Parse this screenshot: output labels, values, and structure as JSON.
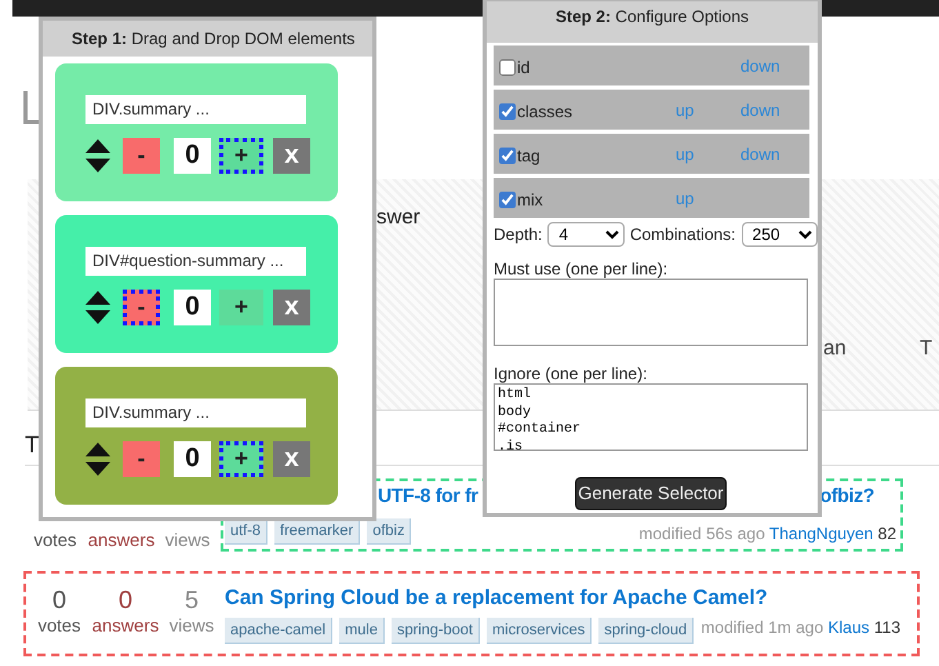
{
  "hero": {
    "text": "swer",
    "captions": [
      "an",
      "T"
    ]
  },
  "section_title": "T",
  "questions": [
    {
      "kind": "partial",
      "color": "#3ed98a",
      "votes_label": "votes",
      "answers_label": "answers",
      "views_label": "views",
      "title_parts": [
        "UTF-8 for fr",
        "ofbiz?"
      ],
      "tags": [
        "utf-8",
        "freemarker",
        "ofbiz"
      ],
      "modified": "modified 56s ago",
      "user": "ThangNguyen",
      "reputation": "82"
    },
    {
      "kind": "full",
      "color": "#f05a5a",
      "votes": "0",
      "votes_label": "votes",
      "answers": "0",
      "answers_label": "answers",
      "views": "5",
      "views_label": "views",
      "title_parts": [
        "Can Spring Cloud be a replacement for Apache Camel?"
      ],
      "tags": [
        "apache-camel",
        "mule",
        "spring-boot",
        "microservices",
        "spring-cloud"
      ],
      "modified": "modified 1m ago",
      "user": "Klaus",
      "reputation": "113"
    }
  ],
  "step1": {
    "title": "**Step 1:** Drag and Drop DOM elements",
    "elements": [
      {
        "label": "DIV.summary ...",
        "minus": "-",
        "count": "0",
        "plus": "+",
        "remove": "x",
        "color": "#75eba8",
        "minus_outlined": false,
        "plus_outlined": true
      },
      {
        "label": "DIV#question-summary ...",
        "minus": "-",
        "count": "0",
        "plus": "+",
        "remove": "x",
        "color": "#45efa9",
        "minus_outlined": true,
        "plus_outlined": false
      },
      {
        "label": "DIV.summary ...",
        "minus": "-",
        "count": "0",
        "plus": "+",
        "remove": "x",
        "color": "#93b146",
        "minus_outlined": false,
        "plus_outlined": true
      }
    ]
  },
  "step2": {
    "title": "**Step 2:** Configure Options",
    "options": [
      {
        "label": "id",
        "checked": false,
        "down": "down"
      },
      {
        "label": "classes",
        "checked": true,
        "up": "up",
        "down": "down"
      },
      {
        "label": "tag",
        "checked": true,
        "up": "up",
        "down": "down"
      },
      {
        "label": "mix",
        "checked": true,
        "up": "up"
      }
    ],
    "selects": [
      {
        "label": "Depth:",
        "value": "4"
      },
      {
        "label": "Combinations:",
        "value": "250"
      }
    ],
    "must_use": {
      "label": "Must use (one per line):"
    },
    "ignore": {
      "label": "Ignore (one per line):",
      "value": "html\nbody\n#container\n.is"
    },
    "generate_button": "Generate Selector"
  }
}
